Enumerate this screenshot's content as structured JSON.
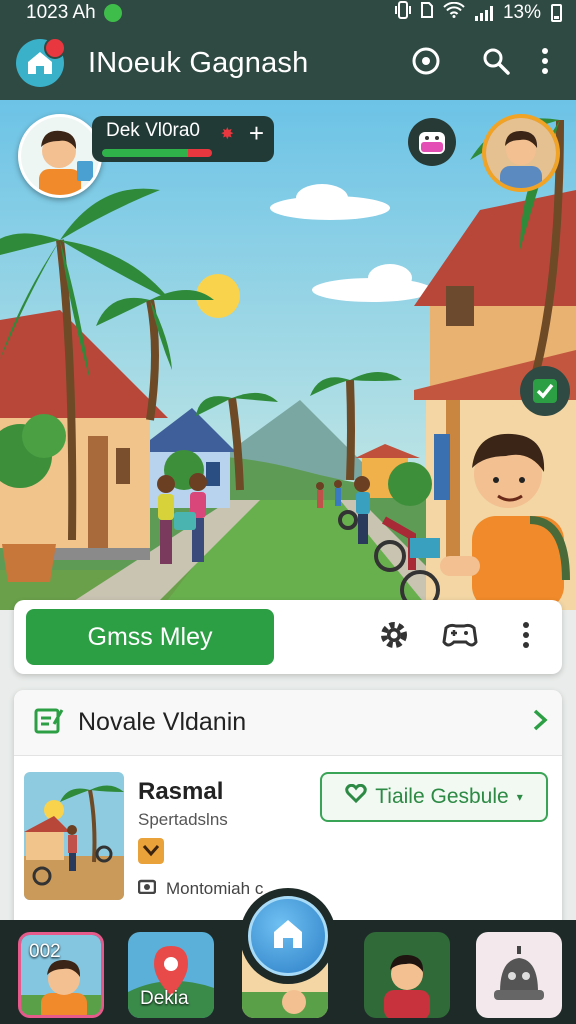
{
  "status_bar": {
    "time": "1023 Ah",
    "battery": "13%"
  },
  "app_bar": {
    "title": "INoeuk Gagnash",
    "icons": [
      "app-logo-icon",
      "target-icon",
      "search-icon",
      "more-vert-icon"
    ]
  },
  "hud": {
    "player_name": "Dek Vl0ra0",
    "add_label": "+",
    "health_fraction": 0.78
  },
  "action_card": {
    "play_label": "Gmss Mley",
    "icons": [
      "gear-icon",
      "controller-icon",
      "more-vert-icon"
    ]
  },
  "news": {
    "header": "Novale Vldanin",
    "item_title": "Rasmal",
    "item_subtitle": "Spertadslns",
    "item_meta": "Montomiah c",
    "schedule_label": "Tiaile Gesbule"
  },
  "bottom_nav": {
    "item1_label": "002",
    "item2_label": "Dekia"
  },
  "colors": {
    "app_bar": "#2f4a43",
    "primary_green": "#2c9f45",
    "accent_red": "#e8373f",
    "fab_blue": "#2c7fc6"
  }
}
